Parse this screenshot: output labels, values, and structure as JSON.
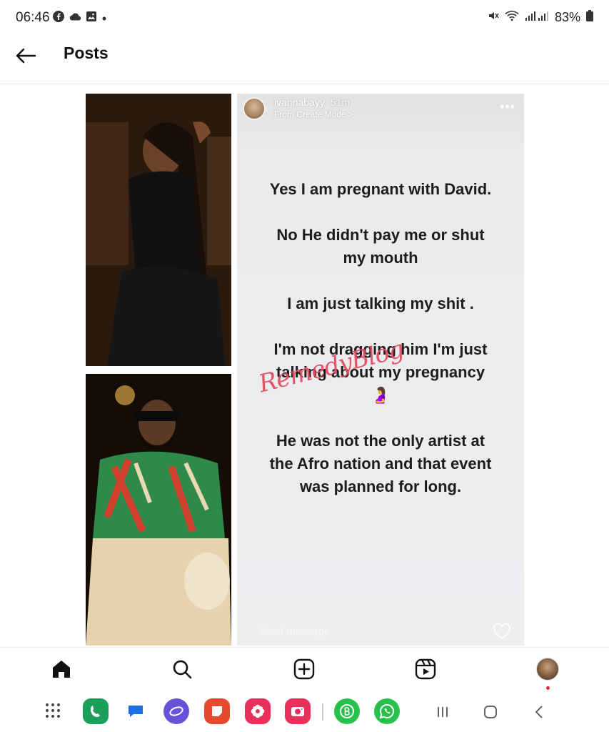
{
  "status_bar": {
    "time": "06:46",
    "battery": "83%",
    "left_icons": [
      "facebook-icon",
      "cloud-icon",
      "image-icon",
      "dot-icon"
    ],
    "right_icons": [
      "mute-icon",
      "wifi-icon",
      "signal-icon",
      "battery-icon"
    ]
  },
  "header": {
    "title": "Posts",
    "back_icon": "arrow-left-icon"
  },
  "story": {
    "username": "ivannabayy",
    "time_ago": "51m",
    "mode": "From Create Mode >",
    "more": "•••",
    "paragraphs": [
      "Yes I am pregnant with David.",
      "No He didn't pay me or shut my mouth",
      "I am just talking my shit .",
      "I'm not dragging him I'm just talking about my pregnancy 🤰",
      "He was not the only artist at the Afro nation and that event was planned for long."
    ],
    "watermark": "RemedyBlog",
    "send_message_placeholder": "Send message"
  },
  "bottom_nav": {
    "items": [
      "home-icon",
      "search-icon",
      "create-icon",
      "reels-icon",
      "profile-avatar"
    ]
  },
  "dock": {
    "apps": [
      {
        "name": "app-grid",
        "color": "#ffffff"
      },
      {
        "name": "phone-app",
        "color": "#1ba05a"
      },
      {
        "name": "messages-app",
        "color": "#ffffff"
      },
      {
        "name": "internet-app",
        "color": "#6a52d8"
      },
      {
        "name": "notes-app",
        "color": "#e64a2e"
      },
      {
        "name": "gallery-app",
        "color": "#e8305a"
      },
      {
        "name": "camera-app",
        "color": "#e8305a"
      },
      {
        "name": "whatsapp-business-app",
        "color": "#26c04a"
      },
      {
        "name": "whatsapp-app",
        "color": "#26c04a"
      }
    ],
    "system_buttons": [
      "recents-icon",
      "home-button-icon",
      "back-button-icon"
    ]
  },
  "colors": {
    "accent_red": "#ee2a3a",
    "watermark_pink": "#e34a5e",
    "story_background": "#eeedf0"
  }
}
